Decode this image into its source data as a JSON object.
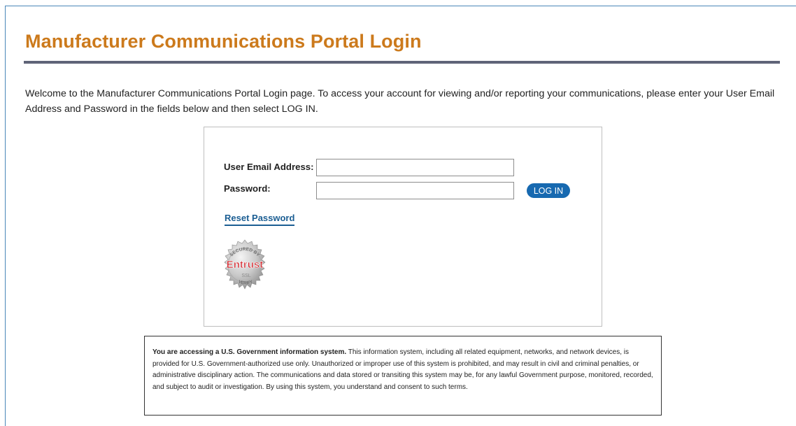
{
  "page": {
    "title": "Manufacturer Communications Portal Login",
    "intro": "Welcome to the Manufacturer Communications Portal Login page. To access your account for viewing and/or reporting your communications, please enter your User Email Address and Password in the fields below and then select LOG IN."
  },
  "login": {
    "email_label": "User Email Address:",
    "email_value": "",
    "password_label": "Password:",
    "password_value": "",
    "login_button": "LOG IN",
    "reset_link": "Reset Password"
  },
  "seal": {
    "icon": "entrust-secured-seal-icon",
    "top_text": "SECURED BY",
    "brand": "Entrust",
    "mid_text": "SSL",
    "bottom_text": "VERIFY"
  },
  "notice": {
    "lead": "You are accessing a U.S. Government information system.",
    "body": " This information system, including all related equipment, networks, and network devices, is provided for U.S. Government-authorized use only. Unauthorized or improper use of this system is prohibited, and may result in civil and criminal penalties, or administrative disciplinary action. The communications and data stored or transiting this system may be, for any lawful Government purpose, monitored, recorded, and subject to audit or investigation. By using this system, you understand and consent to such terms."
  },
  "colors": {
    "title": "#cc7a1c",
    "rule": "#5f6478",
    "button": "#1769b0",
    "link": "#1b5e93",
    "seal_brand": "#d21f26"
  }
}
